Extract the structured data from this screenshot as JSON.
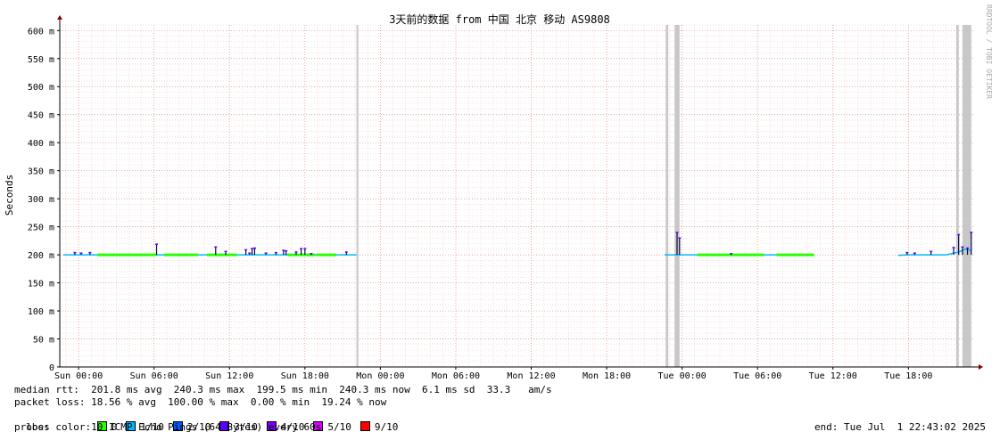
{
  "chart_data": {
    "type": "line",
    "title": "3天前的数据 from 中国 北京 移动 AS9808",
    "ylabel": "Seconds",
    "xlabel": "",
    "watermark": "RRDTOOL / TOBI OETIKER",
    "ylim": [
      0,
      610
    ],
    "xlim_hours": [
      -1.5,
      71.3
    ],
    "y_ticks": [
      {
        "v": 0,
        "label": "0"
      },
      {
        "v": 50,
        "label": "50 m"
      },
      {
        "v": 100,
        "label": "100 m"
      },
      {
        "v": 150,
        "label": "150 m"
      },
      {
        "v": 200,
        "label": "200 m"
      },
      {
        "v": 250,
        "label": "250 m"
      },
      {
        "v": 300,
        "label": "300 m"
      },
      {
        "v": 350,
        "label": "350 m"
      },
      {
        "v": 400,
        "label": "400 m"
      },
      {
        "v": 450,
        "label": "450 m"
      },
      {
        "v": 500,
        "label": "500 m"
      },
      {
        "v": 550,
        "label": "550 m"
      },
      {
        "v": 600,
        "label": "600 m"
      }
    ],
    "x_ticks": [
      {
        "h": 0,
        "label": "Sun 00:00"
      },
      {
        "h": 6,
        "label": "Sun 06:00"
      },
      {
        "h": 12,
        "label": "Sun 12:00"
      },
      {
        "h": 18,
        "label": "Sun 18:00"
      },
      {
        "h": 24,
        "label": "Mon 00:00"
      },
      {
        "h": 30,
        "label": "Mon 06:00"
      },
      {
        "h": 36,
        "label": "Mon 12:00"
      },
      {
        "h": 42,
        "label": "Mon 18:00"
      },
      {
        "h": 48,
        "label": "Tue 00:00"
      },
      {
        "h": 54,
        "label": "Tue 06:00"
      },
      {
        "h": 60,
        "label": "Tue 12:00"
      },
      {
        "h": 66,
        "label": "Tue 18:00"
      }
    ],
    "loss_bands_hours": [
      [
        22.1,
        22.25
      ],
      [
        46.7,
        46.9
      ],
      [
        47.4,
        47.8
      ],
      [
        69.8,
        70.0
      ],
      [
        70.3,
        71.0
      ]
    ],
    "series": [
      {
        "name": "median rtt",
        "segments": [
          [
            [
              -1.2,
              200
            ],
            [
              0,
              200
            ],
            [
              1.5,
              200
            ],
            [
              3,
              200
            ],
            [
              4.5,
              200
            ],
            [
              6,
              200
            ],
            [
              7.5,
              200
            ],
            [
              9,
              200
            ],
            [
              10.5,
              200
            ],
            [
              12,
              200
            ],
            [
              13.5,
              200
            ],
            [
              15,
              200
            ],
            [
              16.5,
              200
            ],
            [
              18,
              200
            ],
            [
              19.5,
              200
            ],
            [
              21,
              200
            ],
            [
              22.1,
              200
            ]
          ],
          [
            [
              46.6,
              200
            ],
            [
              47.2,
              200
            ],
            [
              48,
              200
            ],
            [
              49.5,
              200
            ],
            [
              51,
              200
            ],
            [
              52.5,
              200
            ],
            [
              54,
              200
            ],
            [
              55.5,
              200
            ],
            [
              57,
              200
            ],
            [
              58.5,
              200
            ]
          ],
          [
            [
              65.2,
              199
            ],
            [
              66,
              200
            ],
            [
              67,
              200
            ],
            [
              68,
              200
            ],
            [
              69,
              200
            ],
            [
              70,
              205
            ],
            [
              70.5,
              210
            ],
            [
              71.0,
              208
            ]
          ]
        ]
      }
    ],
    "green_segments_hours": [
      [
        1.5,
        6.2
      ],
      [
        6.8,
        9.5
      ],
      [
        10.2,
        12.6
      ],
      [
        16.6,
        18.8
      ],
      [
        18.9,
        20.5
      ],
      [
        49.2,
        54.5
      ],
      [
        55.5,
        58.5
      ]
    ],
    "spikes": [
      {
        "h": -0.3,
        "v": 204
      },
      {
        "h": 0.2,
        "v": 203
      },
      {
        "h": 0.9,
        "v": 204
      },
      {
        "h": 6.2,
        "v": 219
      },
      {
        "h": 10.9,
        "v": 214
      },
      {
        "h": 11.7,
        "v": 206
      },
      {
        "h": 13.3,
        "v": 209
      },
      {
        "h": 13.6,
        "v": 203
      },
      {
        "h": 13.8,
        "v": 211
      },
      {
        "h": 14.0,
        "v": 212
      },
      {
        "h": 14.9,
        "v": 203
      },
      {
        "h": 15.7,
        "v": 204
      },
      {
        "h": 16.3,
        "v": 208
      },
      {
        "h": 16.5,
        "v": 207
      },
      {
        "h": 17.3,
        "v": 205
      },
      {
        "h": 17.7,
        "v": 211
      },
      {
        "h": 18.0,
        "v": 211
      },
      {
        "h": 18.5,
        "v": 202
      },
      {
        "h": 21.3,
        "v": 205
      },
      {
        "h": 47.6,
        "v": 240
      },
      {
        "h": 47.8,
        "v": 230
      },
      {
        "h": 51.9,
        "v": 202
      },
      {
        "h": 65.9,
        "v": 204
      },
      {
        "h": 66.5,
        "v": 203
      },
      {
        "h": 67.8,
        "v": 206
      },
      {
        "h": 69.6,
        "v": 213
      },
      {
        "h": 70.0,
        "v": 236
      },
      {
        "h": 70.3,
        "v": 214
      },
      {
        "h": 70.7,
        "v": 212
      },
      {
        "h": 71.0,
        "v": 240
      }
    ]
  },
  "stats": {
    "rtt_line": "median rtt:  201.8 ms avg  240.3 ms max  199.5 ms min  240.3 ms now  6.1 ms sd  33.3   am/s",
    "loss_line": "packet loss: 18.56 % avg  100.00 % max  0.00 % min  19.24 % now",
    "loss_color_label": "loss color: ",
    "loss_colors": [
      {
        "label": "0",
        "color": "#26ff00"
      },
      {
        "label": "1/10",
        "color": "#00b8ff"
      },
      {
        "label": "2/10",
        "color": "#0059ff"
      },
      {
        "label": "3/10",
        "color": "#5e00ff"
      },
      {
        "label": "4/10",
        "color": "#7e00ff"
      },
      {
        "label": "5/10",
        "color": "#dd00ff"
      },
      {
        "label": "9/10",
        "color": "#ff0000"
      }
    ],
    "probe_line": "probe:       10 ICMP Echo Pings (64 Bytes) every 60s",
    "end_line": "end: Tue Jul  1 22:43:02 2025"
  }
}
